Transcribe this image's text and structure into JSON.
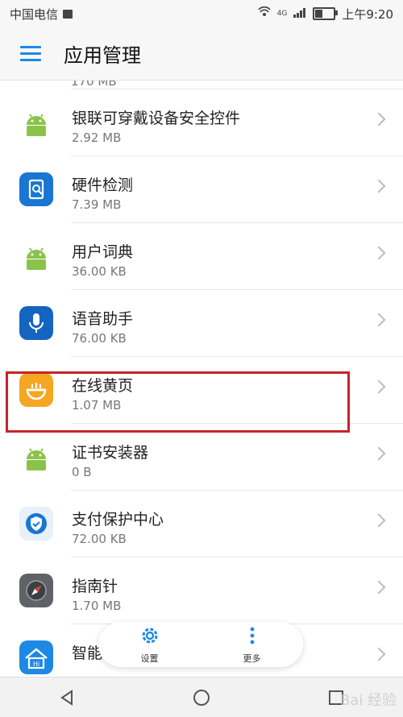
{
  "status_bar": {
    "carrier": "中国电信",
    "network": "4G",
    "time": "上午9:20"
  },
  "header": {
    "title": "应用管理"
  },
  "partial_item": {
    "size": "170 MB"
  },
  "apps": [
    {
      "name": "银联可穿戴设备安全控件",
      "size": "2.92 MB",
      "icon": "android-icon"
    },
    {
      "name": "硬件检测",
      "size": "7.39 MB",
      "icon": "hardware-check-icon"
    },
    {
      "name": "用户词典",
      "size": "36.00 KB",
      "icon": "android-icon"
    },
    {
      "name": "语音助手",
      "size": "76.00 KB",
      "icon": "microphone-icon"
    },
    {
      "name": "在线黄页",
      "size": "1.07 MB",
      "icon": "yellow-pages-icon"
    },
    {
      "name": "证书安装器",
      "size": "0 B",
      "icon": "android-icon"
    },
    {
      "name": "支付保护中心",
      "size": "72.00 KB",
      "icon": "shield-check-icon"
    },
    {
      "name": "指南针",
      "size": "1.70 MB",
      "icon": "compass-icon"
    },
    {
      "name": "智能家居",
      "size": "",
      "icon": "smart-home-icon"
    }
  ],
  "toolbar": {
    "settings_label": "设置",
    "more_label": "更多"
  },
  "watermark": "Bai 经验",
  "colors": {
    "accent": "#1e88e5",
    "highlight": "#c4242a",
    "android": "#8bc34a"
  }
}
